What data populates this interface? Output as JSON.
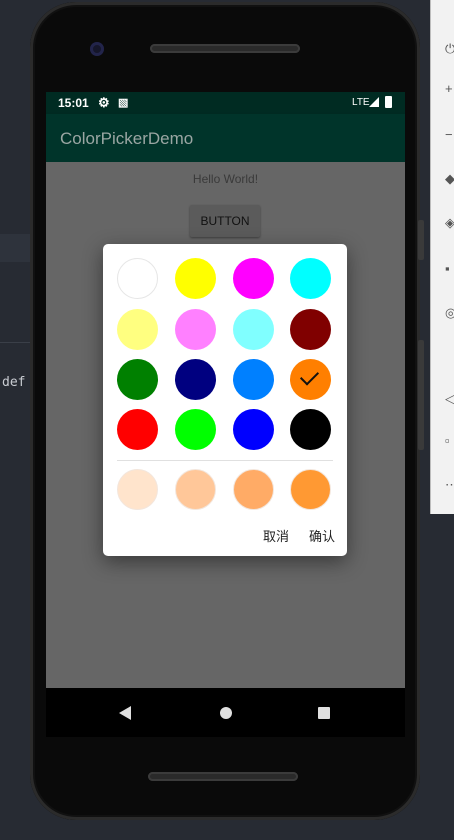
{
  "background": {
    "ide_snippet": "def"
  },
  "status_bar": {
    "time": "15:01",
    "network": "LTE",
    "background_color": "#002b22"
  },
  "app_bar": {
    "title": "ColorPickerDemo",
    "background_color": "#00342a"
  },
  "main": {
    "greeting": "Hello World!",
    "button_label": "BUTTON"
  },
  "color_picker_dialog": {
    "selected_color": "#ff7f00",
    "palette_rows": [
      [
        "#ffffff",
        "#ffff00",
        "#ff00ff",
        "#00ffff"
      ],
      [
        "#ffff80",
        "#ff80ff",
        "#80ffff",
        "#800000"
      ],
      [
        "#008000",
        "#000080",
        "#0080ff",
        "#ff7f00"
      ],
      [
        "#ff0000",
        "#00ff00",
        "#0000ff",
        "#000000"
      ]
    ],
    "recent_colors": [
      "#ffe4cc",
      "#ffc799",
      "#ffab66",
      "#ff9933"
    ],
    "cancel_label": "取消",
    "confirm_label": "确认"
  },
  "nav_bar": {
    "icons": [
      "back-icon",
      "home-icon",
      "recents-icon"
    ]
  }
}
